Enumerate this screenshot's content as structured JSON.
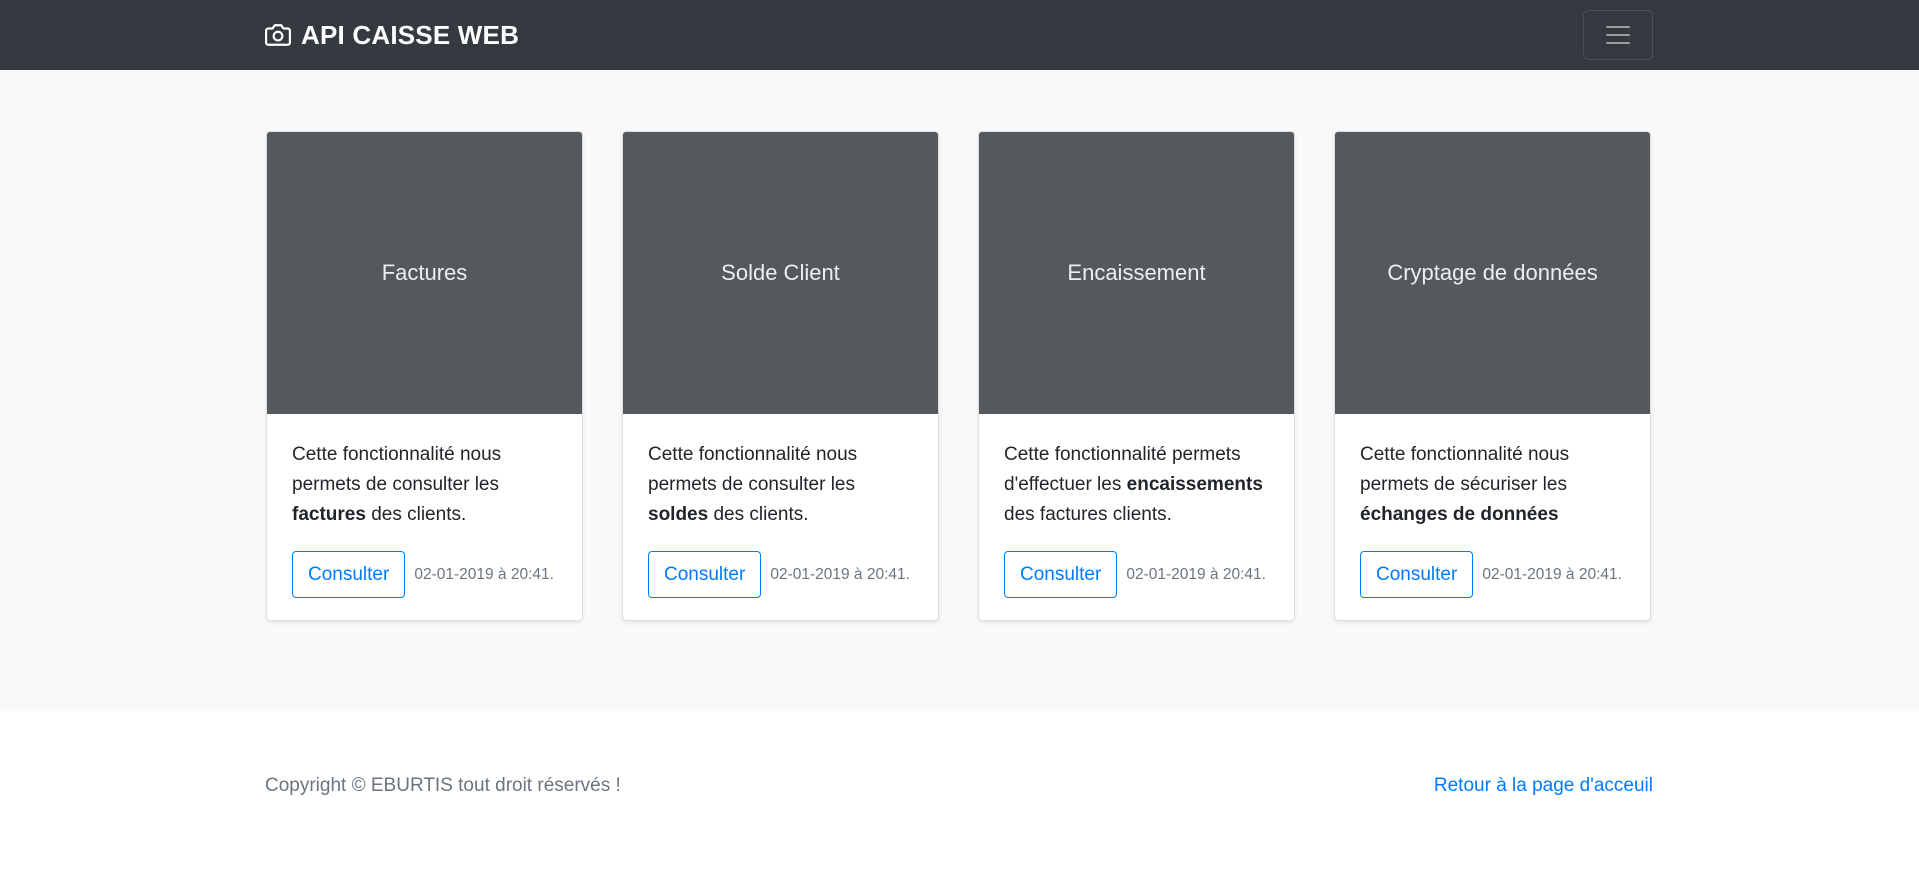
{
  "navbar": {
    "brand_icon": "camera-icon",
    "brand_text": "API CAISSE WEB",
    "toggler_icon": "hamburger-menu-icon",
    "background": "#343a40"
  },
  "cards": [
    {
      "title": "Factures",
      "text_before": "Cette fonctionnalité nous permets de consulter les ",
      "text_bold": "factures",
      "text_after": " des clients.",
      "button_label": "Consulter",
      "date": "02-01-2019 à 20:41."
    },
    {
      "title": "Solde Client",
      "text_before": "Cette fonctionnalité nous permets de consulter les ",
      "text_bold": "soldes",
      "text_after": " des clients.",
      "button_label": "Consulter",
      "date": "02-01-2019 à 20:41."
    },
    {
      "title": "Encaissement",
      "text_before": "Cette fonctionnalité permets d'effectuer les ",
      "text_bold": "encaissements",
      "text_after": " des factures clients.",
      "button_label": "Consulter",
      "date": "02-01-2019 à 20:41."
    },
    {
      "title": "Cryptage de données",
      "text_before": "Cette fonctionnalité nous permets de sécuriser les ",
      "text_bold": "échanges de données",
      "text_after": "",
      "button_label": "Consulter",
      "date": "02-01-2019 à 20:41."
    }
  ],
  "footer": {
    "copyright": "Copyright © EBURTIS tout droit réservés !",
    "back_link": "Retour à la page d'acceuil"
  },
  "colors": {
    "accent": "#007bff",
    "card_header": "#55595c",
    "muted": "#6c757d",
    "section_bg": "#f8f9fa"
  }
}
